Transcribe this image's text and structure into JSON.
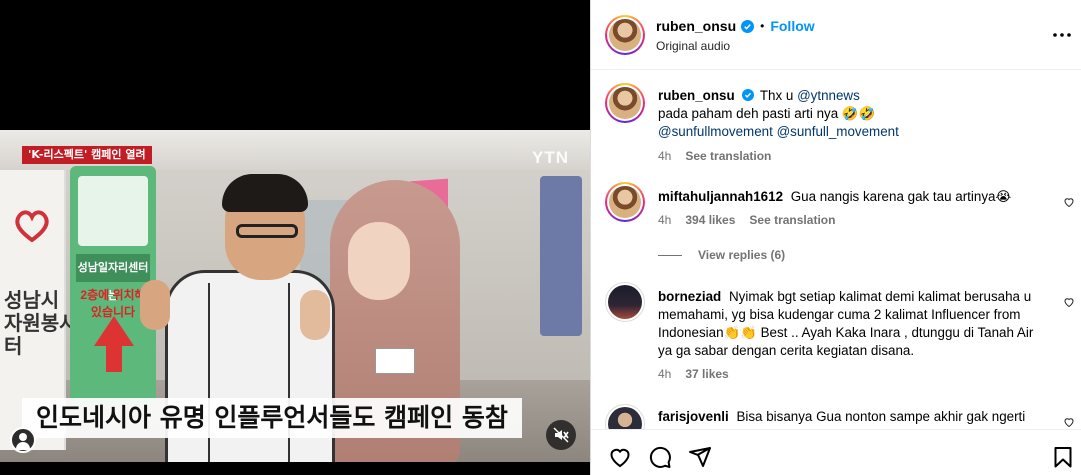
{
  "video": {
    "badge_red": "'K-리스펙트' 캠페인 열려",
    "broadcaster_logo": "YTN",
    "caption": "인도네시아 유명 인플루언서들도 캠페인 동참",
    "left_sign_text": "성남시\n자원봉사\n터",
    "green_sign_band": "성남일자리센터는",
    "green_sign_red": "2층에 위치해\n있습니다",
    "mute_icon": "speaker-muted-icon"
  },
  "header": {
    "username": "ruben_onsu",
    "separator": "•",
    "follow_label": "Follow",
    "audio_label": "Original audio",
    "more_icon": "more-horizontal-icon"
  },
  "caption_post": {
    "username": "ruben_onsu",
    "text_prefix": "Thx u ",
    "mention1": "@ytnnews",
    "line2": "pada paham deh pasti arti nya 🤣🤣",
    "mention2": "@sunfullmovement",
    "mention3": "@sunfull_movement",
    "time": "4h",
    "see_translation": "See translation"
  },
  "comments": [
    {
      "username": "miftahuljannah1612",
      "text": "Gua nangis karena gak tau artinya😭",
      "time": "4h",
      "likes": "394 likes",
      "see_translation": "See translation",
      "view_replies": "View replies (6)"
    },
    {
      "username": "borneziad",
      "text": "Nyimak bgt setiap kalimat demi kalimat berusaha u memahami, yg bisa kudengar cuma 2 kalimat Influencer from Indonesian👏👏 Best .. Ayah Kaka Inara , dtunggu di Tanah Air ya ga sabar dengan cerita kegiatan disana.",
      "time": "4h",
      "likes": "37 likes"
    },
    {
      "username": "farisjovenli",
      "text": "Bisa bisanya Gua nonton sampe akhir gak ngerti"
    }
  ],
  "icons": {
    "like": "heart-icon",
    "comment": "comment-icon",
    "share": "share-icon",
    "save": "bookmark-icon"
  },
  "colors": {
    "accent": "#0095f6",
    "mention": "#00376b",
    "muted": "#737373",
    "badge": "#c01d24"
  }
}
